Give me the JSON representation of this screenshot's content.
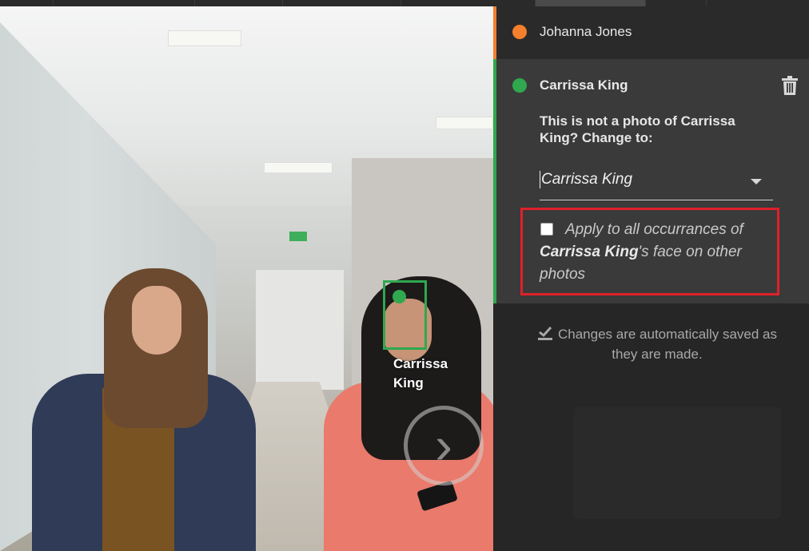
{
  "people": [
    {
      "name": "Johanna Jones",
      "color": "#f47f2c"
    },
    {
      "name": "Carrissa King",
      "color": "#2fa84f"
    }
  ],
  "photo": {
    "face_label": "Carrissa King"
  },
  "detail": {
    "question_prefix": "This is not a photo of ",
    "question_name": "Carrissa King",
    "question_suffix": "? Change to:",
    "selected_person": "Carrissa King",
    "apply_prefix": "Apply to all occurrances of ",
    "apply_name": "Carrissa King",
    "apply_suffix": "'s face on other photos",
    "apply_checked": false
  },
  "footer": {
    "save_note": "Changes are automatically saved as they are made."
  },
  "colors": {
    "highlight": "#e0202a",
    "panel_bg": "#232323"
  },
  "icons": {
    "delete": "trash-icon",
    "saved": "check-save-icon",
    "next": "chevron-right-icon"
  }
}
